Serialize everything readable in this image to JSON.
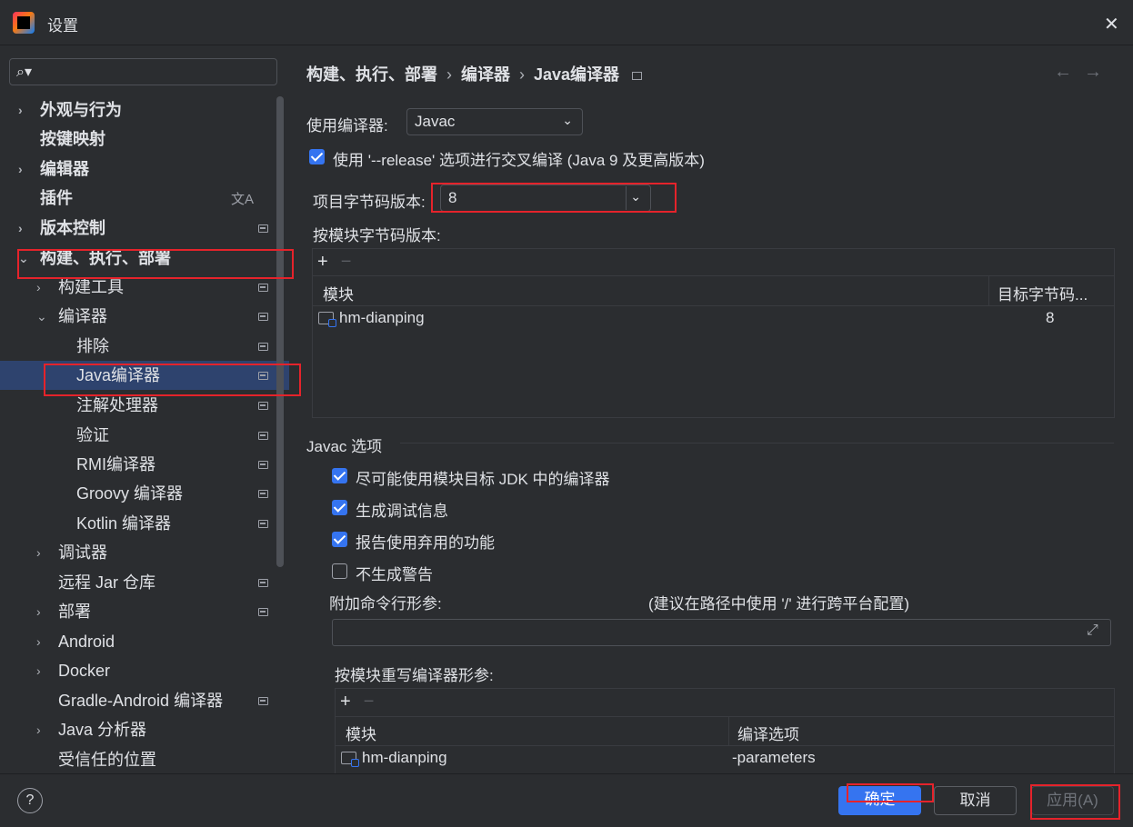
{
  "window": {
    "title": "设置",
    "close_glyph": "✕"
  },
  "sidebar": {
    "search_placeholder": "",
    "items": [
      {
        "label": "外观与行为",
        "expandable": true
      },
      {
        "label": "按键映射",
        "expandable": false
      },
      {
        "label": "编辑器",
        "expandable": true
      },
      {
        "label": "插件",
        "expandable": false
      },
      {
        "label": "版本控制",
        "expandable": true
      },
      {
        "label": "构建、执行、部署",
        "expandable": true,
        "expanded": true
      },
      {
        "label": "构建工具",
        "expandable": true
      },
      {
        "label": "编译器",
        "expandable": true,
        "expanded": true
      },
      {
        "label": "排除"
      },
      {
        "label": "Java编译器",
        "selected": true
      },
      {
        "label": "注解处理器"
      },
      {
        "label": "验证"
      },
      {
        "label": "RMI编译器"
      },
      {
        "label": "Groovy 编译器"
      },
      {
        "label": "Kotlin 编译器"
      },
      {
        "label": "调试器",
        "expandable": true
      },
      {
        "label": "远程 Jar 仓库"
      },
      {
        "label": "部署",
        "expandable": true
      },
      {
        "label": "Android",
        "expandable": true
      },
      {
        "label": "Docker",
        "expandable": true
      },
      {
        "label": "Gradle-Android 编译器"
      },
      {
        "label": "Java 分析器",
        "expandable": true
      },
      {
        "label": "受信任的位置"
      }
    ]
  },
  "breadcrumb": {
    "part1": "构建、执行、部署",
    "part2": "编译器",
    "part3": "Java编译器",
    "sep": "›"
  },
  "main": {
    "use_compiler_label": "使用编译器:",
    "use_compiler_value": "Javac",
    "release_option_label": "使用 '--release' 选项进行交叉编译 (Java 9 及更高版本)",
    "bytecode_label": "项目字节码版本:",
    "bytecode_value": "8",
    "per_module_bytecode_label": "按模块字节码版本:",
    "module_table": {
      "col_module": "模块",
      "col_target": "目标字节码...",
      "rows": [
        {
          "module": "hm-dianping",
          "target": "8"
        }
      ]
    },
    "javac_section": "Javac 选项",
    "options": [
      {
        "label": "尽可能使用模块目标 JDK 中的编译器",
        "checked": true
      },
      {
        "label": "生成调试信息",
        "checked": true
      },
      {
        "label": "报告使用弃用的功能",
        "checked": true
      },
      {
        "label": "不生成警告",
        "checked": false
      }
    ],
    "extra_args_label": "附加命令行形参:",
    "extra_args_hint": "(建议在路径中使用 '/' 进行跨平台配置)",
    "extra_args_value": "",
    "override_label": "按模块重写编译器形参:",
    "override_table": {
      "col_module": "模块",
      "col_options": "编译选项",
      "rows": [
        {
          "module": "hm-dianping",
          "options": "-parameters"
        }
      ]
    },
    "add_glyph": "+",
    "remove_glyph": "−"
  },
  "footer": {
    "help": "?",
    "ok": "确定",
    "cancel": "取消",
    "apply": "应用(A)"
  },
  "colors": {
    "accent": "#3574f0",
    "background": "#2b2d30",
    "selection": "#2e436e",
    "annotation_red": "#e5232b"
  }
}
